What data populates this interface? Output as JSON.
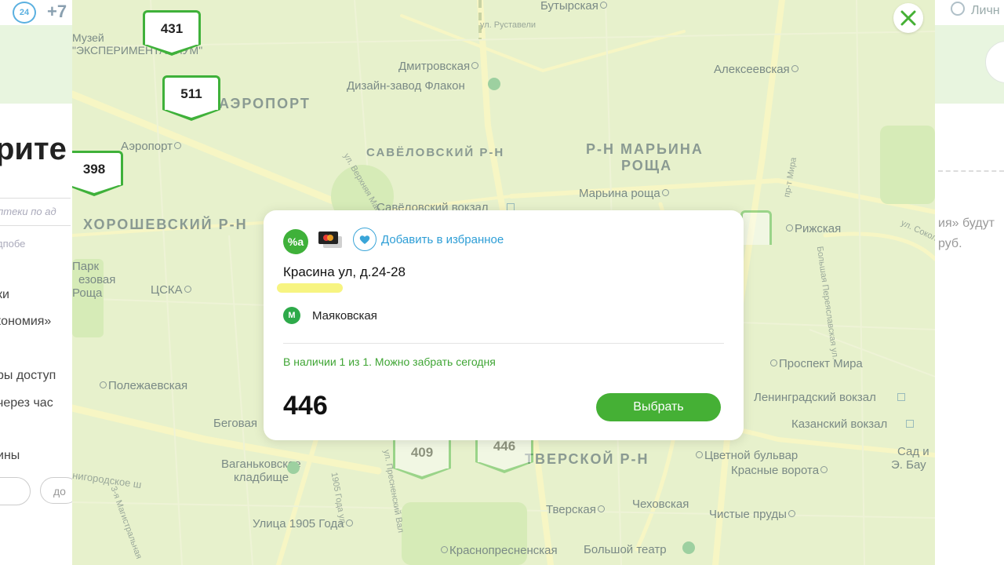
{
  "background": {
    "logo_text": "24",
    "phone": "+7",
    "user_label": "Личн",
    "heading": "рите",
    "search_placeholder": "аптеки по ад",
    "links": [
      "дпобе",
      "ки",
      "кономия»",
      "ры доступ",
      "через час",
      "ины"
    ],
    "pill_text": "до",
    "right_texts": [
      "ия» будут",
      "руб."
    ]
  },
  "map": {
    "markers": [
      {
        "value": "431",
        "faded": false
      },
      {
        "value": "511",
        "faded": false
      },
      {
        "value": "398",
        "faded": false
      },
      {
        "value": "409",
        "faded": true
      },
      {
        "value": "446",
        "faded": true
      }
    ],
    "districts": [
      "АЭРОПОРТ",
      "САВЁЛОВСКИЙ Р-Н",
      "Р-Н МАРЬИНА",
      "РОЩА",
      "ХОРОШЕВСКИЙ Р-Н",
      "ТВЕРСКОЙ Р-Н"
    ],
    "places": [
      "Бутырская",
      "Музей",
      "\"ЭКСПЕРИМЕНТАНИУМ\"",
      "Дмитровская",
      "Алексеевская",
      "Дизайн-завод Флакон",
      "Аэропорт",
      "Марьина роща",
      "Савёловский вокзал",
      "Рижская",
      "Парк",
      "езовая",
      "Роща",
      "ЦСКА",
      "Полежаевская",
      "Проспект Мира",
      "Ленинградский вокзал",
      "Беговая",
      "Казанский вокзал",
      "Ваганьковское",
      "кладбище",
      "Цветной бульвар",
      "Красные ворота",
      "Сад и",
      "Э. Бау",
      "Тверская",
      "Чеховская",
      "Чистые пруды",
      "Улица 1905 Года",
      "Краснопресненская",
      "Большой театр"
    ],
    "streets": [
      "ул. Руставели",
      "ул. Верхняя Масловка",
      "1905 Года ул.",
      "ул. Пресненский Вал",
      "Хорошевское ш",
      "нигородское ш",
      "пр-т Мира",
      "Большая Переяславская ул.",
      "ул. Сокол",
      "3-я Магистральная"
    ]
  },
  "card": {
    "discount_badge": "%a",
    "favorite_label": "Добавить в избранное",
    "address": "Красина ул, д.24-28",
    "metro_letter": "М",
    "metro_station": "Маяковская",
    "availability": "В наличии 1 из 1. Можно забрать сегодня",
    "price": "446",
    "choose_label": "Выбрать"
  },
  "colors": {
    "brand_green": "#45b035",
    "link_blue": "#2e9ed6",
    "map_tint": "#e7f1cc"
  },
  "icons": [
    "close-icon",
    "heart-icon",
    "bank-card-icon",
    "discount-icon",
    "metro-icon",
    "user-icon",
    "cart-icon"
  ]
}
